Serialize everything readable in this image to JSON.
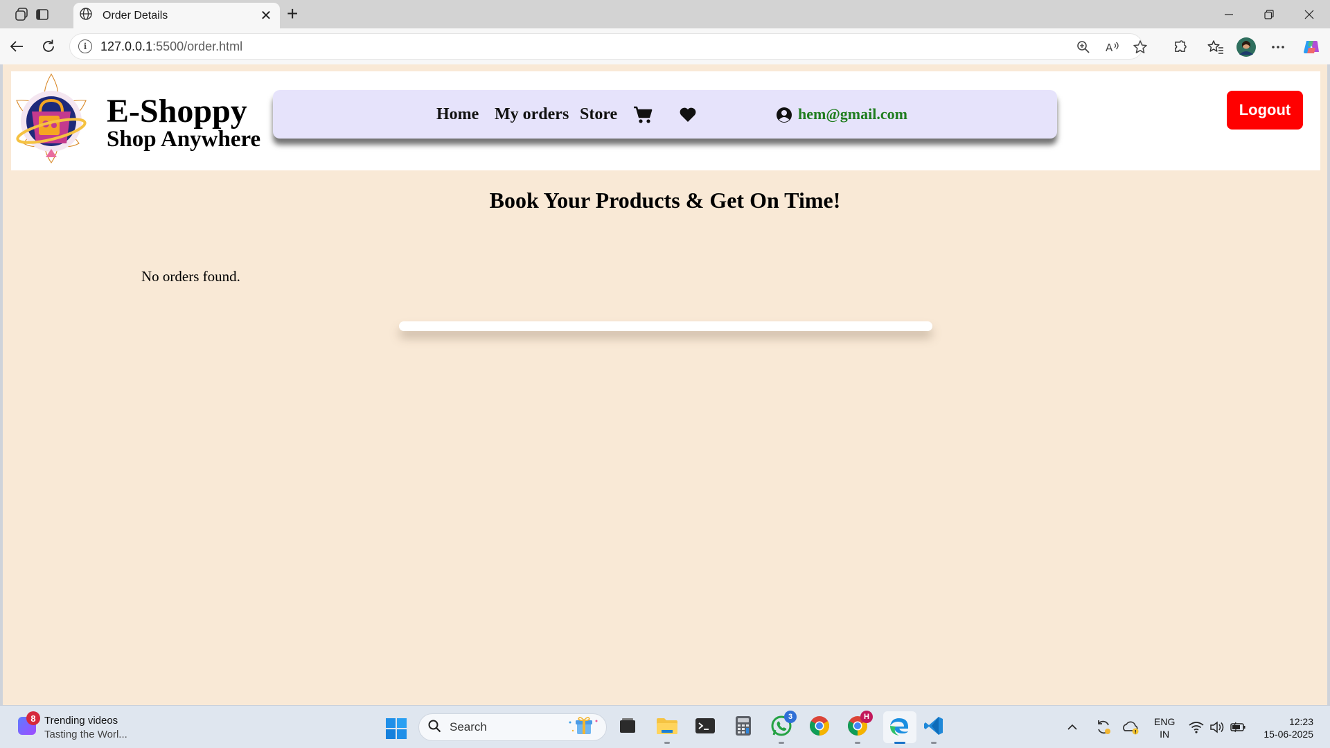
{
  "browser": {
    "tab_title": "Order Details",
    "address_host": "127.0.0.1",
    "address_path": ":5500/order.html"
  },
  "site": {
    "brand_title": "E-Shoppy",
    "brand_subtitle": "Shop Anywhere",
    "nav": {
      "home": "Home",
      "my_orders": "My orders",
      "store": "Store",
      "user_email": "hem@gmail.com"
    },
    "logout_label": "Logout",
    "heading": "Book Your Products & Get On Time!",
    "empty_message": "No orders found.",
    "colors": {
      "page_bg": "#f9e9d6",
      "nav_bg": "#e6e3fb",
      "logout_bg": "#ff0000",
      "email_color": "#1f7d1f"
    }
  },
  "taskbar": {
    "widget_badge": "8",
    "widget_title": "Trending videos",
    "widget_subtitle": "Tasting the Worl...",
    "search_placeholder": "Search",
    "whatsapp_badge": "3",
    "chrome_profile_badge": "H",
    "lang_line1": "ENG",
    "lang_line2": "IN",
    "time": "12:23",
    "date": "15-06-2025"
  }
}
